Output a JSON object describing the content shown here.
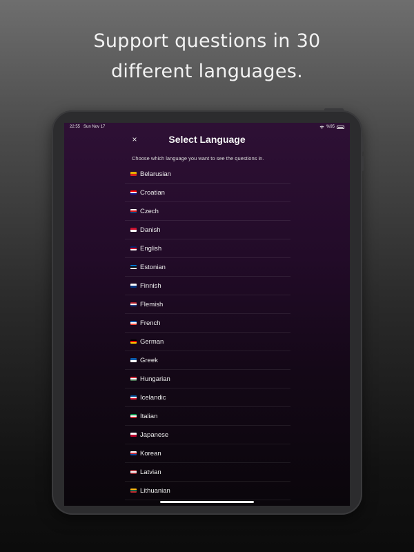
{
  "headline": {
    "line1": "Support questions in 30",
    "line2": "different languages."
  },
  "status_bar": {
    "time": "22:55",
    "date": "Sun Nov 17",
    "battery": "%95"
  },
  "header": {
    "close_icon": "×",
    "title": "Select Language",
    "subtitle": "Choose which language you want to see the questions in."
  },
  "languages": [
    {
      "name": "Belarusian",
      "flag_colors": [
        "#e5b000",
        "#d9251d"
      ]
    },
    {
      "name": "Croatian",
      "flag_colors": [
        "#ff0000",
        "#ffffff",
        "#171796"
      ]
    },
    {
      "name": "Czech",
      "flag_colors": [
        "#ffffff",
        "#d7141a",
        "#11457e"
      ]
    },
    {
      "name": "Danish",
      "flag_colors": [
        "#c8102e",
        "#ffffff"
      ]
    },
    {
      "name": "English",
      "flag_colors": [
        "#012169",
        "#c8102e",
        "#ffffff"
      ]
    },
    {
      "name": "Estonian",
      "flag_colors": [
        "#0072ce",
        "#000000",
        "#ffffff"
      ]
    },
    {
      "name": "Finnish",
      "flag_colors": [
        "#ffffff",
        "#003580"
      ]
    },
    {
      "name": "Flemish",
      "flag_colors": [
        "#ae1c28",
        "#ffffff",
        "#21468b"
      ]
    },
    {
      "name": "French",
      "flag_colors": [
        "#0055a4",
        "#ffffff",
        "#ef4135"
      ]
    },
    {
      "name": "German",
      "flag_colors": [
        "#000000",
        "#dd0000",
        "#ffce00"
      ]
    },
    {
      "name": "Greek",
      "flag_colors": [
        "#0d5eaf",
        "#ffffff"
      ]
    },
    {
      "name": "Hungarian",
      "flag_colors": [
        "#ce2939",
        "#ffffff",
        "#477050"
      ]
    },
    {
      "name": "Icelandic",
      "flag_colors": [
        "#02529c",
        "#ffffff",
        "#dc1e35"
      ]
    },
    {
      "name": "Italian",
      "flag_colors": [
        "#009246",
        "#ffffff",
        "#ce2b37"
      ]
    },
    {
      "name": "Japanese",
      "flag_colors": [
        "#ffffff",
        "#bc002d"
      ]
    },
    {
      "name": "Korean",
      "flag_colors": [
        "#ffffff",
        "#cd2e3a",
        "#0047a0"
      ]
    },
    {
      "name": "Latvian",
      "flag_colors": [
        "#9e3039",
        "#ffffff",
        "#9e3039"
      ]
    },
    {
      "name": "Lithuanian",
      "flag_colors": [
        "#fdb913",
        "#006a44",
        "#c1272d"
      ]
    }
  ]
}
